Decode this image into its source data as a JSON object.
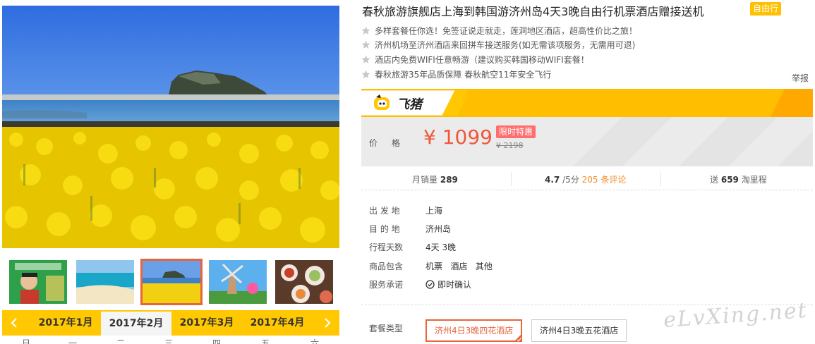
{
  "product": {
    "title": "春秋旅游旗舰店上海到韩国游济州岛4天3晚自由行机票酒店赠接送机",
    "badge": "自由行"
  },
  "features": [
    "多样套餐任你选！免签证说走就走，莲洞地区酒店，超高性价比之旅！",
    "济州机场至济州酒店来回拼车接送服务(如无需该项服务，无需用可退)",
    "酒店内免费WIFI任意畅游（建议购买韩国移动WIFI套餐！",
    "春秋旅游35年品质保障 春秋航空11年安全飞行"
  ],
  "report_link": "举报",
  "platform": {
    "name": "飞猪",
    "logo_icon": "fliggy-pig-logo",
    "bar_color": "#ffbf00"
  },
  "price": {
    "label": "价格",
    "current": "¥ 1099",
    "deal_tag": "限时特惠",
    "original": "¥ 2198",
    "accent_color": "#f0573a"
  },
  "stats": {
    "monthly_sales_label": "月销量",
    "monthly_sales": "289",
    "rating": "4.7",
    "rating_suffix": "/5分",
    "reviews": "205 条评论",
    "miles_prefix": "送",
    "miles": "659",
    "miles_suffix": "淘里程"
  },
  "specs": [
    {
      "label": "出 发 地",
      "value": "上海"
    },
    {
      "label": "目 的 地",
      "value": "济州岛"
    },
    {
      "label": "行程天数",
      "value": "4天 3晚"
    },
    {
      "label": "商品包含",
      "value": "机票   酒店   其他"
    },
    {
      "label": "服务承诺",
      "value": "即时确认"
    }
  ],
  "package": {
    "label": "套餐类型",
    "options": [
      "济州4日3晚四花酒店",
      "济州4日3晚五花酒店"
    ],
    "selected": 0
  },
  "calendar": {
    "months": [
      "2017年1月",
      "2017年2月",
      "2017年3月",
      "2017年4月"
    ],
    "active_month": 1,
    "weekdays": [
      "日",
      "一",
      "二",
      "三",
      "四",
      "五",
      "六"
    ]
  },
  "gallery": {
    "thumbnails": [
      "costumed-person-photo",
      "beach-photo",
      "canola-field-photo",
      "windmill-photo",
      "food-dishes-photo"
    ],
    "active_thumbnail": 2
  },
  "watermark": "eLvXing.net"
}
